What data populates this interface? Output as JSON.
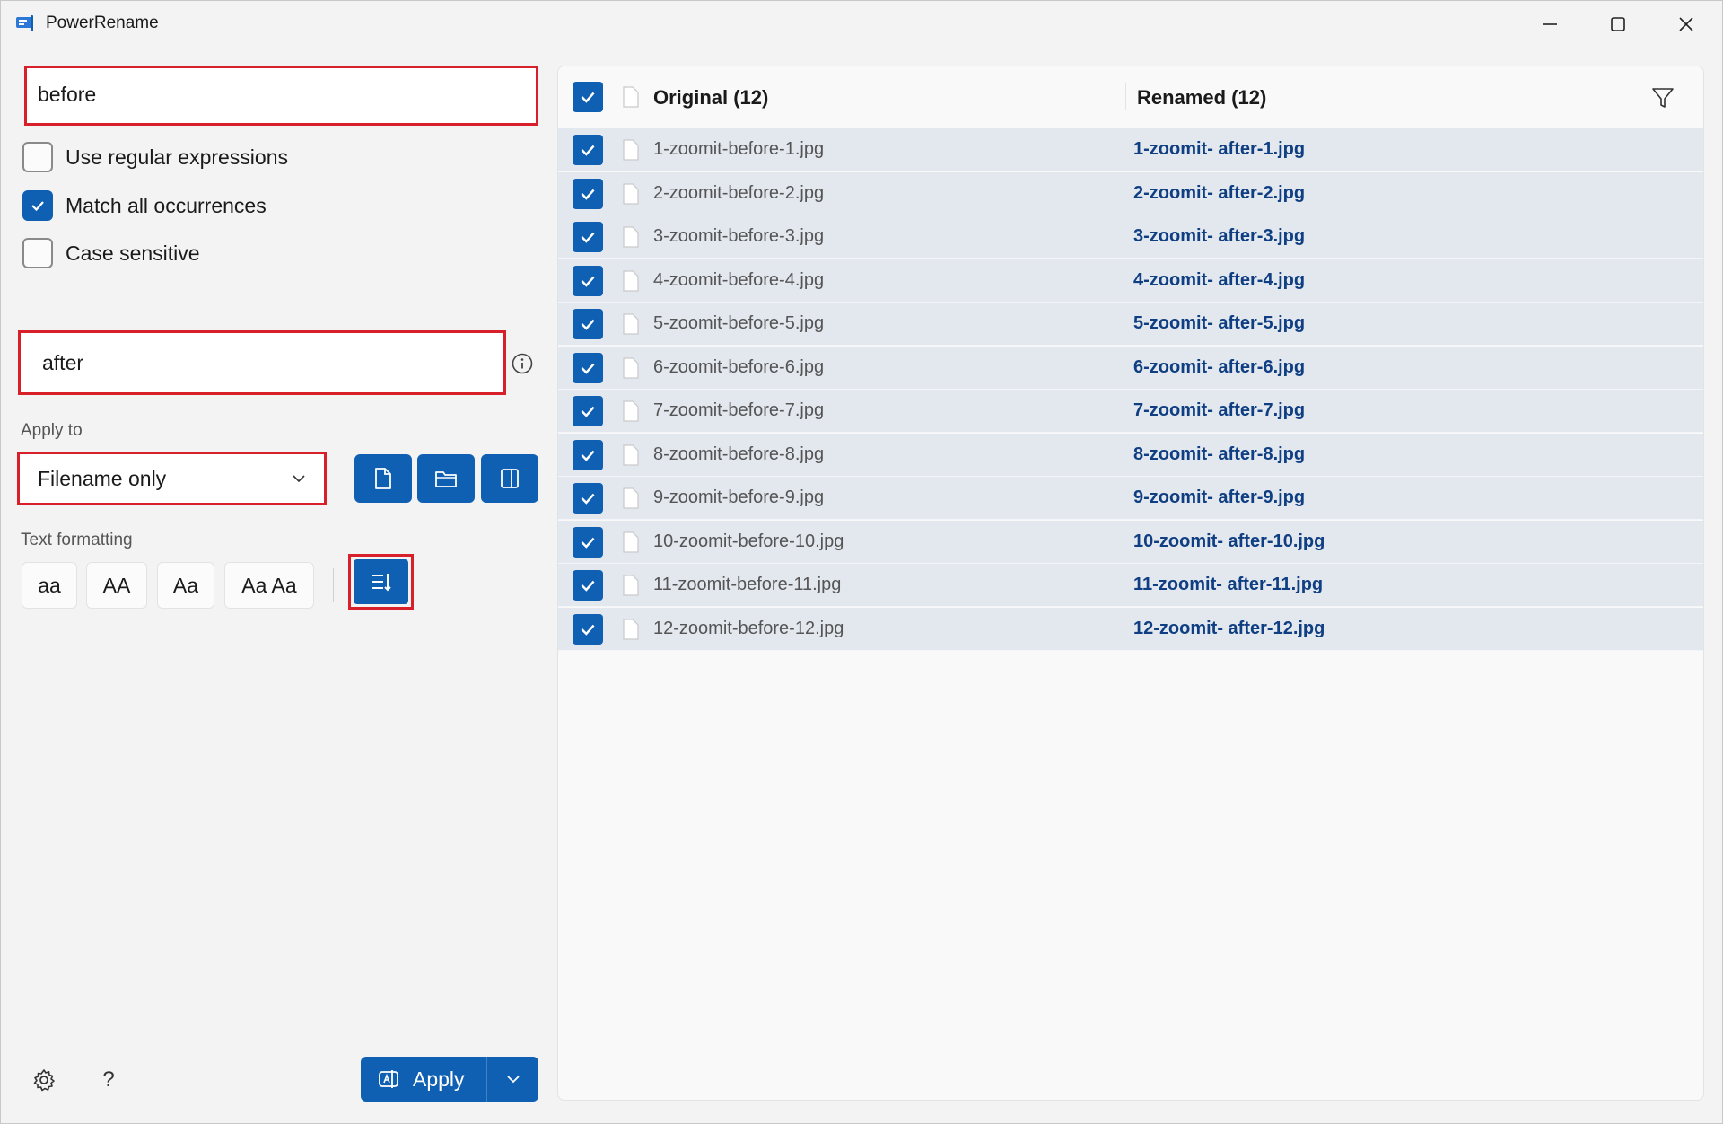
{
  "window": {
    "title": "PowerRename",
    "accent_color": "#0f5fb3",
    "highlight_color": "#d8202a",
    "controls": [
      "minimize-icon",
      "maximize-icon",
      "close-icon"
    ]
  },
  "search": {
    "value": "before",
    "options": [
      {
        "label": "Use regular expressions",
        "checked": false
      },
      {
        "label": "Match all occurrences",
        "checked": true
      },
      {
        "label": "Case sensitive",
        "checked": false
      }
    ]
  },
  "replace": {
    "value": "after",
    "info_icon": "info-icon"
  },
  "apply_to": {
    "label": "Apply to",
    "selected": "Filename only",
    "buttons": [
      "file-icon",
      "folder-icon",
      "subfolder-icon"
    ]
  },
  "text_formatting": {
    "label": "Text formatting",
    "buttons": [
      "aa",
      "AA",
      "Aa",
      "Aa Aa"
    ],
    "enumerate_icon": "enumerate-icon"
  },
  "footer": {
    "settings_icon": "gear-icon",
    "help_label": "?",
    "apply_label": "Apply"
  },
  "list": {
    "original_header": "Original (12)",
    "renamed_header": "Renamed (12)",
    "all_checked": true,
    "filter_icon": "filter-icon",
    "rows": [
      {
        "original": "1-zoomit-before-1.jpg",
        "renamed": "1-zoomit- after-1.jpg",
        "checked": true
      },
      {
        "original": "2-zoomit-before-2.jpg",
        "renamed": "2-zoomit- after-2.jpg",
        "checked": true
      },
      {
        "original": "3-zoomit-before-3.jpg",
        "renamed": "3-zoomit- after-3.jpg",
        "checked": true
      },
      {
        "original": "4-zoomit-before-4.jpg",
        "renamed": "4-zoomit- after-4.jpg",
        "checked": true
      },
      {
        "original": "5-zoomit-before-5.jpg",
        "renamed": "5-zoomit- after-5.jpg",
        "checked": true
      },
      {
        "original": "6-zoomit-before-6.jpg",
        "renamed": "6-zoomit- after-6.jpg",
        "checked": true
      },
      {
        "original": "7-zoomit-before-7.jpg",
        "renamed": "7-zoomit- after-7.jpg",
        "checked": true
      },
      {
        "original": "8-zoomit-before-8.jpg",
        "renamed": "8-zoomit- after-8.jpg",
        "checked": true
      },
      {
        "original": "9-zoomit-before-9.jpg",
        "renamed": "9-zoomit- after-9.jpg",
        "checked": true
      },
      {
        "original": "10-zoomit-before-10.jpg",
        "renamed": "10-zoomit- after-10.jpg",
        "checked": true
      },
      {
        "original": "11-zoomit-before-11.jpg",
        "renamed": "11-zoomit- after-11.jpg",
        "checked": true
      },
      {
        "original": "12-zoomit-before-12.jpg",
        "renamed": "12-zoomit- after-12.jpg",
        "checked": true
      }
    ]
  }
}
